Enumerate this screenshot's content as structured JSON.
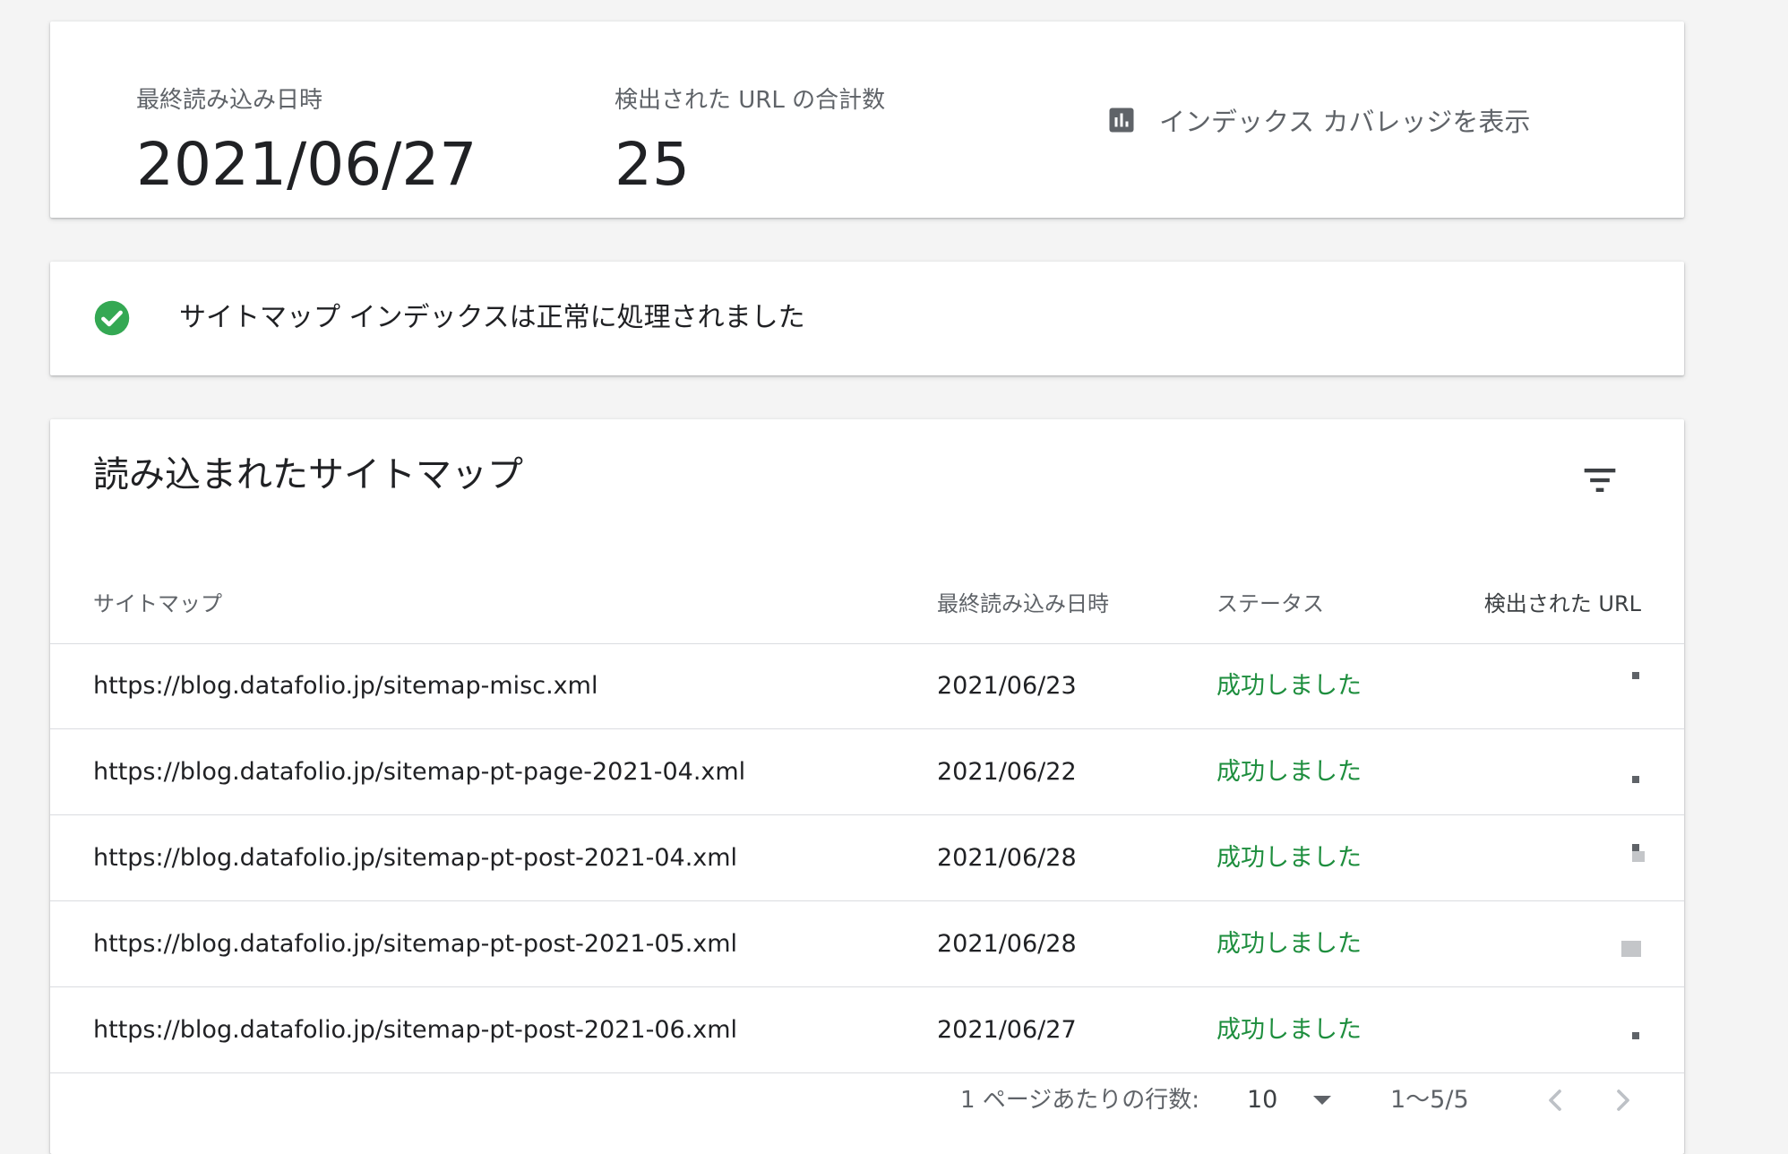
{
  "summary": {
    "last_read_label": "最終読み込み日時",
    "last_read_value": "2021/06/27",
    "discovered_label": "検出された URL の合計数",
    "discovered_value": "25",
    "coverage_link": "インデックス カバレッジを表示",
    "coverage_icon": "bar-chart-icon"
  },
  "status": {
    "icon": "check-circle-icon",
    "message": "サイトマップ インデックスは正常に処理されました",
    "color": "#34a853"
  },
  "table": {
    "title": "読み込まれたサイトマップ",
    "filter_icon": "filter-icon",
    "columns": [
      "サイトマップ",
      "最終読み込み日時",
      "ステータス",
      "検出された URL"
    ],
    "rows": [
      {
        "sitemap": "https://blog.datafolio.jp/sitemap-misc.xml",
        "date": "2021/06/23",
        "status": "成功しました"
      },
      {
        "sitemap": "https://blog.datafolio.jp/sitemap-pt-page-2021-04.xml",
        "date": "2021/06/22",
        "status": "成功しました"
      },
      {
        "sitemap": "https://blog.datafolio.jp/sitemap-pt-post-2021-04.xml",
        "date": "2021/06/28",
        "status": "成功しました"
      },
      {
        "sitemap": "https://blog.datafolio.jp/sitemap-pt-post-2021-05.xml",
        "date": "2021/06/28",
        "status": "成功しました"
      },
      {
        "sitemap": "https://blog.datafolio.jp/sitemap-pt-post-2021-06.xml",
        "date": "2021/06/27",
        "status": "成功しました"
      }
    ],
    "status_color": "#1e8e3e"
  },
  "pagination": {
    "rows_per_page_label": "1 ページあたりの行数:",
    "rows_per_page": "10",
    "range": "1〜5/5",
    "prev_icon": "chevron-left-icon",
    "next_icon": "chevron-right-icon"
  }
}
